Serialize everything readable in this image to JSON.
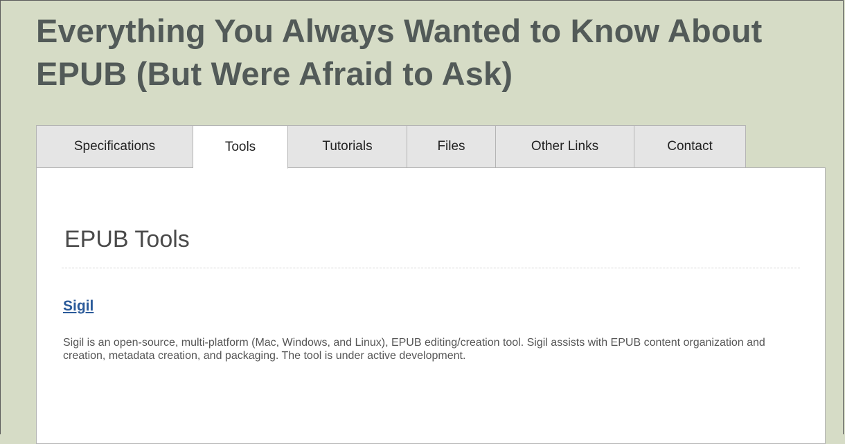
{
  "site": {
    "title": "Everything You Always Wanted to Know About EPUB (But Were Afraid to Ask)"
  },
  "tabs": [
    {
      "label": "Specifications",
      "active": false
    },
    {
      "label": "Tools",
      "active": true
    },
    {
      "label": "Tutorials",
      "active": false
    },
    {
      "label": "Files",
      "active": false
    },
    {
      "label": "Other Links",
      "active": false
    },
    {
      "label": "Contact",
      "active": false
    }
  ],
  "content": {
    "heading": "EPUB Tools",
    "tools": [
      {
        "name": "Sigil",
        "description": "Sigil is an open-source, multi-platform (Mac, Windows, and Linux), EPUB editing/creation tool. Sigil assists with EPUB content organization and creation, metadata creation, and packaging. The tool is under active development."
      }
    ]
  },
  "colors": {
    "page_background": "#d6dcc6",
    "title_text": "#525a58",
    "tab_inactive": "#e5e5e5",
    "tab_active": "#ffffff",
    "link": "#2a5a9a"
  }
}
